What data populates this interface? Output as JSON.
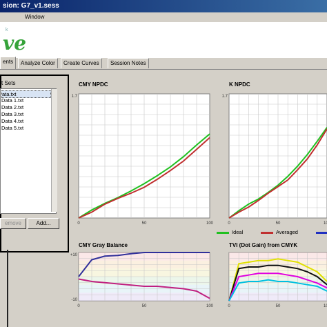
{
  "window": {
    "title": "sion: G7_v1.sess"
  },
  "menu": {
    "item": "Window"
  },
  "logo": {
    "text": "ve",
    "small": "k"
  },
  "tabs": [
    {
      "label": "ents",
      "active": true
    },
    {
      "label": "Analyze Color",
      "active": false
    },
    {
      "label": "Create Curves",
      "active": false
    },
    {
      "label": "Session Notes",
      "active": false
    }
  ],
  "datasets": {
    "title": "t Sets",
    "items": [
      "ata.txt",
      "Data 1.txt",
      "Data 2.txt",
      "Data 3.txt",
      "Data 4.txt",
      "Data 5.txt"
    ],
    "selected_index": 0,
    "remove_label": "emove",
    "add_label": "Add..."
  },
  "legend": [
    {
      "label": "Ideal",
      "color": "#20c020"
    },
    {
      "label": "Averaged",
      "color": "#c03030"
    },
    {
      "label": "",
      "color": "#2030c0"
    }
  ],
  "chart_data": [
    {
      "type": "line",
      "title": "CMY NPDC",
      "x": [
        0,
        10,
        20,
        30,
        40,
        50,
        60,
        70,
        80,
        90,
        100
      ],
      "xticks": [
        "0",
        "50",
        "100"
      ],
      "ytick_top": "1.7",
      "xlim": [
        0,
        100
      ],
      "ylim": [
        0,
        1.7
      ],
      "series": [
        {
          "name": "Ideal",
          "color": "#20c020",
          "values": [
            0,
            0.11,
            0.2,
            0.28,
            0.37,
            0.47,
            0.58,
            0.7,
            0.84,
            1.0,
            1.15
          ]
        },
        {
          "name": "Averaged",
          "color": "#c03030",
          "values": [
            0,
            0.08,
            0.19,
            0.27,
            0.34,
            0.42,
            0.53,
            0.65,
            0.78,
            0.94,
            1.1
          ]
        }
      ],
      "grid": true
    },
    {
      "type": "line",
      "title": "K NPDC",
      "x": [
        0,
        10,
        20,
        30,
        40,
        50,
        60,
        70,
        80,
        90,
        100
      ],
      "xticks": [
        "0",
        "50",
        "100"
      ],
      "ytick_top": "1.7",
      "xlim": [
        0,
        100
      ],
      "ylim": [
        0,
        1.7
      ],
      "series": [
        {
          "name": "Ideal",
          "color": "#20c020",
          "values": [
            0,
            0.1,
            0.19,
            0.26,
            0.35,
            0.45,
            0.57,
            0.71,
            0.87,
            1.05,
            1.24
          ]
        },
        {
          "name": "Averaged",
          "color": "#c03030",
          "values": [
            0,
            0.08,
            0.15,
            0.24,
            0.34,
            0.43,
            0.52,
            0.66,
            0.81,
            1.0,
            1.22
          ]
        }
      ],
      "grid": true
    },
    {
      "type": "line",
      "title": "CMY Gray Balance",
      "x": [
        0,
        10,
        20,
        30,
        40,
        50,
        60,
        70,
        80,
        90,
        100
      ],
      "xticks": [
        "0",
        "50",
        "100"
      ],
      "ytick_top": "+10",
      "ytick_bottom": "-10",
      "xlim": [
        0,
        100
      ],
      "ylim": [
        -10,
        10
      ],
      "series": [
        {
          "name": "",
          "color": "#30309a",
          "values": [
            0,
            7,
            8.5,
            8.8,
            9.5,
            10,
            10,
            10,
            10,
            10,
            10
          ]
        },
        {
          "name": "",
          "color": "#c02080",
          "values": [
            -1,
            -2,
            -2.5,
            -3,
            -3.5,
            -4,
            -4,
            -4.5,
            -5,
            -6,
            -9
          ]
        }
      ],
      "grid": true
    },
    {
      "type": "line",
      "title": "TVI (Dot Gain) from CMYK",
      "x": [
        0,
        10,
        20,
        30,
        40,
        50,
        60,
        70,
        80,
        90,
        100
      ],
      "xticks": [
        "0",
        "50",
        "100"
      ],
      "xlim": [
        0,
        100
      ],
      "ylim": [
        0,
        30
      ],
      "series": [
        {
          "name": "",
          "color": "#e0e000",
          "values": [
            0,
            23,
            24,
            25,
            25,
            26,
            25,
            24,
            21,
            18,
            12
          ]
        },
        {
          "name": "",
          "color": "#101010",
          "values": [
            0,
            20,
            21,
            21,
            22,
            22,
            21,
            20,
            18,
            15,
            10
          ]
        },
        {
          "name": "",
          "color": "#e000e0",
          "values": [
            0,
            15,
            16,
            17,
            17,
            17,
            16,
            15,
            13,
            11,
            8
          ]
        },
        {
          "name": "",
          "color": "#00c0e0",
          "values": [
            0,
            11,
            12,
            12,
            13,
            12,
            12,
            11,
            10,
            9,
            6
          ]
        }
      ],
      "grid": true
    }
  ]
}
